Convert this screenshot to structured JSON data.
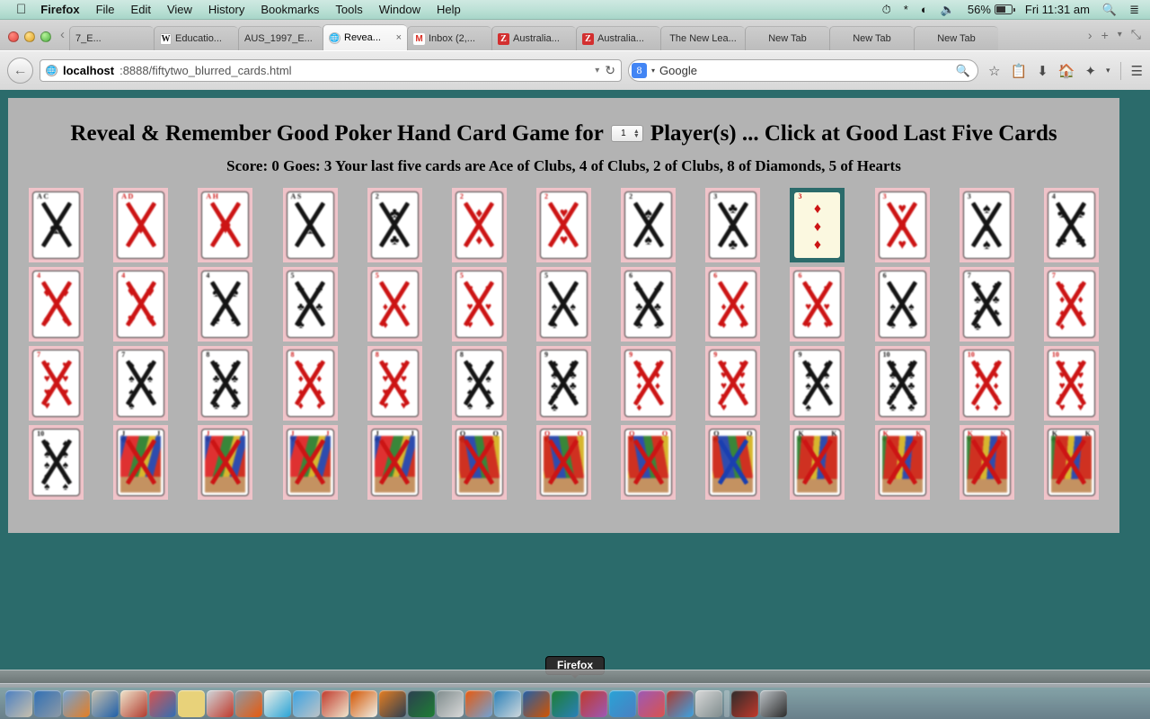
{
  "menubar": {
    "apple_icon": "apple-icon",
    "items": [
      "Firefox",
      "File",
      "Edit",
      "View",
      "History",
      "Bookmarks",
      "Tools",
      "Window",
      "Help"
    ],
    "status": {
      "timemachine_icon": "time-machine-icon",
      "bluetooth_icon": "bluetooth-icon",
      "wifi_icon": "wifi-icon",
      "volume_icon": "volume-icon",
      "battery_percent": "56%",
      "battery_icon": "battery-icon",
      "clock": "Fri 11:31 am",
      "search_icon": "spotlight-search-icon",
      "notification_icon": "notification-center-icon"
    }
  },
  "browser": {
    "window_controls": {
      "close": "close-button",
      "minimize": "minimize-button",
      "zoom": "zoom-button"
    },
    "tab_scroll_left": "‹",
    "tabs": [
      {
        "label": "7_E...",
        "favicon": "none",
        "active": false
      },
      {
        "label": "Educatio...",
        "favicon": "wikipedia",
        "active": false
      },
      {
        "label": "AUS_1997_E...",
        "favicon": "none",
        "active": false
      },
      {
        "label": "Revea...",
        "favicon": "globe",
        "active": true,
        "close_label": "×"
      },
      {
        "label": "Inbox (2,...",
        "favicon": "gmail",
        "active": false
      },
      {
        "label": "Australia...",
        "favicon": "zoho",
        "active": false
      },
      {
        "label": "Australia...",
        "favicon": "zoho",
        "active": false
      },
      {
        "label": "The New Lea...",
        "favicon": "none",
        "active": false
      },
      {
        "label": "New Tab",
        "favicon": "none",
        "active": false
      },
      {
        "label": "New Tab",
        "favicon": "none",
        "active": false
      },
      {
        "label": "New Tab",
        "favicon": "none",
        "active": false
      }
    ],
    "tab_scroll_right": "›",
    "new_tab_label": "+",
    "tab_list_label": "▾",
    "fullscreen_label": "⤡",
    "back_label": "←",
    "url": {
      "host": "localhost",
      "rest": ":8888/fiftytwo_blurred_cards.html",
      "dropdown": "▾",
      "reload": "↻"
    },
    "search": {
      "engine": "Google",
      "engine_glyph": "8",
      "caret": "▾",
      "icon": "search-icon"
    },
    "toolbar_icons": [
      "bookmark-star-icon",
      "reader-list-icon",
      "downloads-icon",
      "home-icon",
      "pocket-icon",
      "dropdown-caret-icon",
      "hamburger-menu-icon"
    ]
  },
  "page": {
    "title_before": "Reveal & Remember Good Poker Hand Card Game for",
    "players_value": "1",
    "title_after": "Player(s) ... Click at Good Last Five Cards",
    "score_line": "Score: 0 Goes: 3 Your last five cards are Ace of Clubs, 4 of Clubs, 2 of Clubs, 8 of Diamonds, 5 of Hearts",
    "score": "0",
    "goes": "3",
    "last_five_cards": [
      "Ace of Clubs",
      "4 of Clubs",
      "2 of Clubs",
      "8 of Diamonds",
      "5 of Hearts"
    ],
    "colors": {
      "page_background": "#b3b3b3",
      "page_border": "#2b6b6b",
      "card_frame": "#f0c3c9",
      "selected_frame": "#2b6b6b",
      "red_suit": "#cc1414",
      "black_suit": "#111111"
    },
    "grid": {
      "columns": 13,
      "rows": 4,
      "total_cards": 52
    },
    "cards": [
      {
        "rank": "A",
        "suit": "C",
        "symbol": "♣",
        "color": "blk",
        "pips": 1,
        "label": "A C",
        "crossed": true,
        "cross_color": "xblk",
        "selected": false
      },
      {
        "rank": "A",
        "suit": "D",
        "symbol": "♦",
        "color": "red",
        "pips": 1,
        "label": "A D",
        "crossed": true,
        "cross_color": "xred",
        "selected": false
      },
      {
        "rank": "A",
        "suit": "H",
        "symbol": "♥",
        "color": "red",
        "pips": 1,
        "label": "A H",
        "crossed": true,
        "cross_color": "xred",
        "selected": false
      },
      {
        "rank": "A",
        "suit": "S",
        "symbol": "♠",
        "color": "blk",
        "pips": 1,
        "label": "A S",
        "crossed": true,
        "cross_color": "xblk",
        "selected": false
      },
      {
        "rank": "2",
        "suit": "C",
        "symbol": "♣",
        "color": "blk",
        "pips": 2,
        "label": "2",
        "crossed": true,
        "cross_color": "xblk",
        "selected": false
      },
      {
        "rank": "2",
        "suit": "D",
        "symbol": "♦",
        "color": "red",
        "pips": 2,
        "label": "2",
        "crossed": true,
        "cross_color": "xred",
        "selected": false
      },
      {
        "rank": "2",
        "suit": "H",
        "symbol": "♥",
        "color": "red",
        "pips": 2,
        "label": "2",
        "crossed": true,
        "cross_color": "xred",
        "selected": false
      },
      {
        "rank": "2",
        "suit": "S",
        "symbol": "♠",
        "color": "blk",
        "pips": 2,
        "label": "2",
        "crossed": true,
        "cross_color": "xblk",
        "selected": false
      },
      {
        "rank": "3",
        "suit": "C",
        "symbol": "♣",
        "color": "blk",
        "pips": 3,
        "label": "3",
        "crossed": true,
        "cross_color": "xblk",
        "selected": false
      },
      {
        "rank": "3",
        "suit": "D",
        "symbol": "♦",
        "color": "red",
        "pips": 3,
        "label": "3",
        "crossed": false,
        "cross_color": "",
        "selected": true
      },
      {
        "rank": "3",
        "suit": "H",
        "symbol": "♥",
        "color": "red",
        "pips": 3,
        "label": "3",
        "crossed": true,
        "cross_color": "xred",
        "selected": false
      },
      {
        "rank": "3",
        "suit": "S",
        "symbol": "♠",
        "color": "blk",
        "pips": 3,
        "label": "3",
        "crossed": true,
        "cross_color": "xblk",
        "selected": false
      },
      {
        "rank": "4",
        "suit": "C",
        "symbol": "♣",
        "color": "blk",
        "pips": 4,
        "label": "4",
        "crossed": true,
        "cross_color": "xblk",
        "selected": false
      },
      {
        "rank": "4",
        "suit": "D",
        "symbol": "♦",
        "color": "red",
        "pips": 4,
        "label": "4",
        "crossed": true,
        "cross_color": "xred",
        "selected": false
      },
      {
        "rank": "4",
        "suit": "H",
        "symbol": "♥",
        "color": "red",
        "pips": 4,
        "label": "4",
        "crossed": true,
        "cross_color": "xred",
        "selected": false
      },
      {
        "rank": "4",
        "suit": "S",
        "symbol": "♠",
        "color": "blk",
        "pips": 4,
        "label": "4",
        "crossed": true,
        "cross_color": "xblk",
        "selected": false
      },
      {
        "rank": "5",
        "suit": "C",
        "symbol": "♣",
        "color": "blk",
        "pips": 5,
        "label": "5",
        "crossed": true,
        "cross_color": "xblk",
        "selected": false
      },
      {
        "rank": "5",
        "suit": "D",
        "symbol": "♦",
        "color": "red",
        "pips": 5,
        "label": "5",
        "crossed": true,
        "cross_color": "xred",
        "selected": false
      },
      {
        "rank": "5",
        "suit": "H",
        "symbol": "♥",
        "color": "red",
        "pips": 5,
        "label": "5",
        "crossed": true,
        "cross_color": "xred",
        "selected": false
      },
      {
        "rank": "5",
        "suit": "S",
        "symbol": "♠",
        "color": "blk",
        "pips": 5,
        "label": "5",
        "crossed": true,
        "cross_color": "xblk",
        "selected": false
      },
      {
        "rank": "6",
        "suit": "C",
        "symbol": "♣",
        "color": "blk",
        "pips": 6,
        "label": "6",
        "crossed": true,
        "cross_color": "xblk",
        "selected": false
      },
      {
        "rank": "6",
        "suit": "D",
        "symbol": "♦",
        "color": "red",
        "pips": 6,
        "label": "6",
        "crossed": true,
        "cross_color": "xred",
        "selected": false
      },
      {
        "rank": "6",
        "suit": "H",
        "symbol": "♥",
        "color": "red",
        "pips": 6,
        "label": "6",
        "crossed": true,
        "cross_color": "xred",
        "selected": false
      },
      {
        "rank": "6",
        "suit": "S",
        "symbol": "♠",
        "color": "blk",
        "pips": 6,
        "label": "6",
        "crossed": true,
        "cross_color": "xblk",
        "selected": false
      },
      {
        "rank": "7",
        "suit": "C",
        "symbol": "♣",
        "color": "blk",
        "pips": 7,
        "label": "7",
        "crossed": true,
        "cross_color": "xblk",
        "selected": false
      },
      {
        "rank": "7",
        "suit": "D",
        "symbol": "♦",
        "color": "red",
        "pips": 7,
        "label": "7",
        "crossed": true,
        "cross_color": "xred",
        "selected": false
      },
      {
        "rank": "7",
        "suit": "H",
        "symbol": "♥",
        "color": "red",
        "pips": 7,
        "label": "7",
        "crossed": true,
        "cross_color": "xred",
        "selected": false
      },
      {
        "rank": "7",
        "suit": "S",
        "symbol": "♠",
        "color": "blk",
        "pips": 7,
        "label": "7",
        "crossed": true,
        "cross_color": "xblk",
        "selected": false
      },
      {
        "rank": "8",
        "suit": "C",
        "symbol": "♣",
        "color": "blk",
        "pips": 8,
        "label": "8",
        "crossed": true,
        "cross_color": "xblk",
        "selected": false
      },
      {
        "rank": "8",
        "suit": "D",
        "symbol": "♦",
        "color": "red",
        "pips": 8,
        "label": "8",
        "crossed": true,
        "cross_color": "xred",
        "selected": false
      },
      {
        "rank": "8",
        "suit": "H",
        "symbol": "♥",
        "color": "red",
        "pips": 8,
        "label": "8",
        "crossed": true,
        "cross_color": "xred",
        "selected": false
      },
      {
        "rank": "8",
        "suit": "S",
        "symbol": "♠",
        "color": "blk",
        "pips": 8,
        "label": "8",
        "crossed": true,
        "cross_color": "xblk",
        "selected": false
      },
      {
        "rank": "9",
        "suit": "C",
        "symbol": "♣",
        "color": "blk",
        "pips": 9,
        "label": "9",
        "crossed": true,
        "cross_color": "xblk",
        "selected": false
      },
      {
        "rank": "9",
        "suit": "D",
        "symbol": "♦",
        "color": "red",
        "pips": 9,
        "label": "9",
        "crossed": true,
        "cross_color": "xred",
        "selected": false
      },
      {
        "rank": "9",
        "suit": "H",
        "symbol": "♥",
        "color": "red",
        "pips": 9,
        "label": "9",
        "crossed": true,
        "cross_color": "xred",
        "selected": false
      },
      {
        "rank": "9",
        "suit": "S",
        "symbol": "♠",
        "color": "blk",
        "pips": 9,
        "label": "9",
        "crossed": true,
        "cross_color": "xblk",
        "selected": false
      },
      {
        "rank": "10",
        "suit": "C",
        "symbol": "♣",
        "color": "blk",
        "pips": 10,
        "label": "10",
        "crossed": true,
        "cross_color": "xblk",
        "selected": false
      },
      {
        "rank": "10",
        "suit": "D",
        "symbol": "♦",
        "color": "red",
        "pips": 10,
        "label": "10",
        "crossed": true,
        "cross_color": "xred",
        "selected": false
      },
      {
        "rank": "10",
        "suit": "H",
        "symbol": "♥",
        "color": "red",
        "pips": 10,
        "label": "10",
        "crossed": true,
        "cross_color": "xred",
        "selected": false
      },
      {
        "rank": "10",
        "suit": "S",
        "symbol": "♠",
        "color": "blk",
        "pips": 10,
        "label": "10",
        "crossed": true,
        "cross_color": "xblk",
        "selected": false
      },
      {
        "rank": "J",
        "suit": "C",
        "symbol": "♣",
        "color": "blk",
        "face": "j",
        "label": "J",
        "crossed": true,
        "cross_color": "xred",
        "selected": false
      },
      {
        "rank": "J",
        "suit": "D",
        "symbol": "♦",
        "color": "red",
        "face": "j",
        "label": "J",
        "crossed": true,
        "cross_color": "xred",
        "selected": false
      },
      {
        "rank": "J",
        "suit": "H",
        "symbol": "♥",
        "color": "red",
        "face": "j",
        "label": "J",
        "crossed": true,
        "cross_color": "xred",
        "selected": false
      },
      {
        "rank": "J",
        "suit": "S",
        "symbol": "♠",
        "color": "blk",
        "face": "j",
        "label": "J",
        "crossed": true,
        "cross_color": "xred",
        "selected": false
      },
      {
        "rank": "Q",
        "suit": "C",
        "symbol": "♣",
        "color": "blk",
        "face": "q",
        "label": "Q",
        "crossed": true,
        "cross_color": "xred",
        "selected": false
      },
      {
        "rank": "Q",
        "suit": "D",
        "symbol": "♦",
        "color": "red",
        "face": "q",
        "label": "Q",
        "crossed": true,
        "cross_color": "xred",
        "selected": false
      },
      {
        "rank": "Q",
        "suit": "H",
        "symbol": "♥",
        "color": "red",
        "face": "q",
        "label": "Q",
        "crossed": true,
        "cross_color": "xred",
        "selected": false
      },
      {
        "rank": "Q",
        "suit": "S",
        "symbol": "♠",
        "color": "blk",
        "face": "q",
        "label": "Q",
        "crossed": true,
        "cross_color": "xblue",
        "selected": false
      },
      {
        "rank": "K",
        "suit": "C",
        "symbol": "♣",
        "color": "blk",
        "face": "k",
        "label": "K",
        "crossed": true,
        "cross_color": "xred",
        "selected": false
      },
      {
        "rank": "K",
        "suit": "D",
        "symbol": "♦",
        "color": "red",
        "face": "k",
        "label": "K",
        "crossed": true,
        "cross_color": "xred",
        "selected": false
      },
      {
        "rank": "K",
        "suit": "H",
        "symbol": "♥",
        "color": "red",
        "face": "k",
        "label": "K",
        "crossed": true,
        "cross_color": "xred",
        "selected": false
      },
      {
        "rank": "K",
        "suit": "S",
        "symbol": "♠",
        "color": "blk",
        "face": "k",
        "label": "K",
        "crossed": true,
        "cross_color": "xred",
        "selected": false
      }
    ]
  },
  "desktop": {
    "tooltip": "Firefox",
    "dock_icons": [
      "finder-icon",
      "mail-app-icon",
      "safari-icon",
      "photos-icon",
      "contacts-icon",
      "calendar-icon",
      "notes-icon",
      "preview-icon",
      "disk-utility-icon",
      "textedit-icon",
      "messages-icon",
      "books-icon",
      "itunes-icon",
      "ibooks-icon",
      "app-store-icon",
      "system-preferences-icon",
      "firefox-icon",
      "sketch-icon",
      "word-icon",
      "excel-icon",
      "powerpoint-icon",
      "skype-icon",
      "utilities-icon",
      "acrobat-icon",
      "chrome-icon",
      "terminal-icon",
      "trash-icon"
    ]
  }
}
